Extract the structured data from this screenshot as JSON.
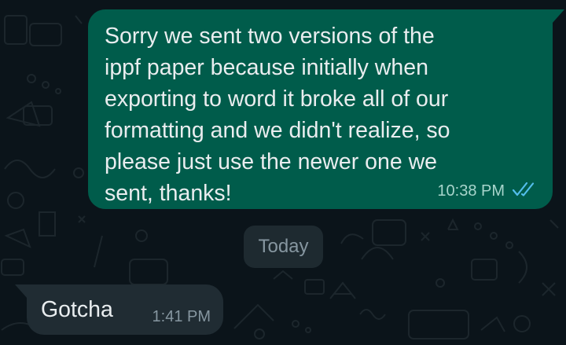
{
  "chat": {
    "outgoing_message": {
      "text": "Sorry we sent two versions of the\nippf paper because initially when\nexporting to word it broke all of our\nformatting and we didn't realize, so\nplease just use the newer one we\nsent, thanks!",
      "time": "10:38 PM",
      "status_icon": "double-check-read-icon",
      "read_color": "#53bdeb"
    },
    "date_separator": "Today",
    "incoming_message": {
      "text": "Gotcha",
      "time": "1:41 PM"
    },
    "colors": {
      "background": "#0b141a",
      "outgoing_bubble": "#005c4b",
      "incoming_bubble": "#202c33"
    }
  }
}
